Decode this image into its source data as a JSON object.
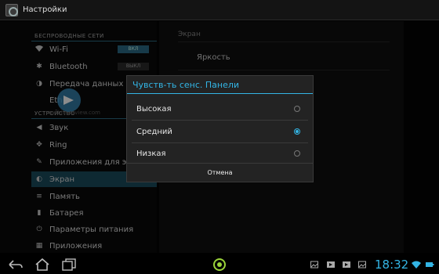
{
  "actionbar": {
    "title": "Настройки"
  },
  "sections": {
    "wireless": "БЕСПРОВОДНЫЕ СЕТИ",
    "device": "УСТРОЙСТВО"
  },
  "left_items": [
    {
      "label": "Wi-Fi",
      "icon": "wifi-icon",
      "toggle": "ВКЛ",
      "toggle_on": true
    },
    {
      "label": "Bluetooth",
      "icon": "bluetooth-icon",
      "toggle": "ВЫКЛ",
      "toggle_on": false
    },
    {
      "label": "Передача данных",
      "icon": "data-usage-icon"
    },
    {
      "label": "Eth",
      "icon": "ethernet-icon"
    },
    {
      "label": "Звук",
      "icon": "sound-icon"
    },
    {
      "label": "Ring",
      "icon": "ring-icon"
    },
    {
      "label": "Приложения для экран",
      "icon": "apps-screen-icon"
    },
    {
      "label": "Экран",
      "icon": "display-icon",
      "selected": true
    },
    {
      "label": "Память",
      "icon": "storage-icon"
    },
    {
      "label": "Батарея",
      "icon": "battery-icon"
    },
    {
      "label": "Параметры питания",
      "icon": "power-icon"
    },
    {
      "label": "Приложения",
      "icon": "apps-icon"
    }
  ],
  "right_pane": {
    "header": "Экран",
    "brightness": "Яркость"
  },
  "watermark": {
    "text": "mobile-review.com"
  },
  "dialog": {
    "title": "Чувств-ть сенс. Панели",
    "options": [
      {
        "label": "Высокая",
        "checked": false
      },
      {
        "label": "Средний",
        "checked": true
      },
      {
        "label": "Низкая",
        "checked": false
      }
    ],
    "cancel": "Отмена"
  },
  "sysbar": {
    "time": "18:32",
    "accent": "#33b5e5"
  }
}
